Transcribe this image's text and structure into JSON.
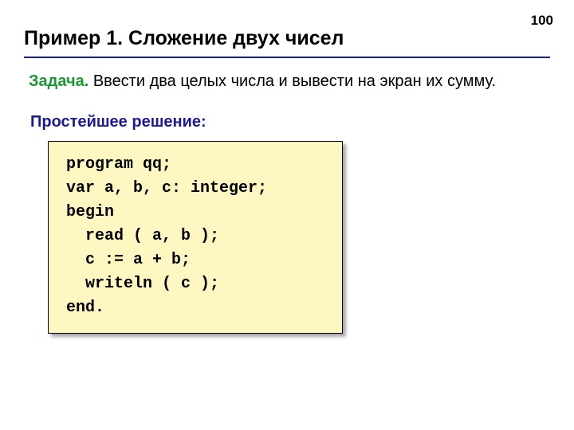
{
  "page_number": "100",
  "title": "Пример 1. Сложение двух чисел",
  "task": {
    "label": "Задача.",
    "body": " Ввести два целых числа и вывести на экран их сумму."
  },
  "subheading": "Простейшее решение:",
  "code": "program qq;\nvar a, b, c: integer;\nbegin\n  read ( a, b );\n  c := a + b;\n  writeln ( c );\nend."
}
